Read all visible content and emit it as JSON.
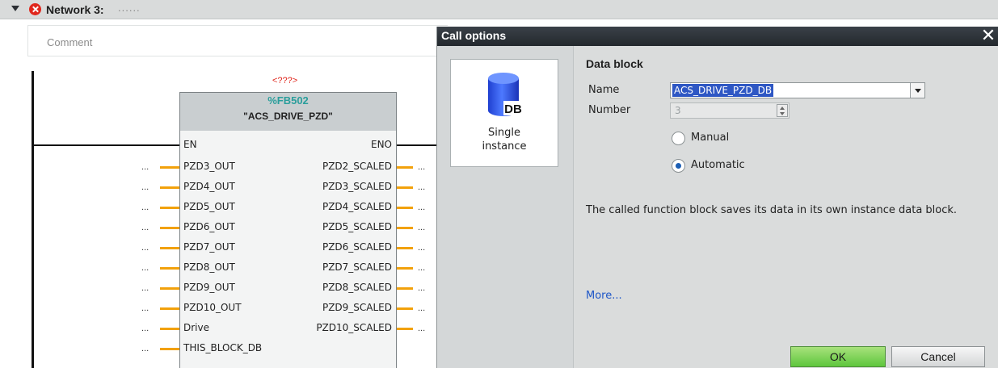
{
  "network": {
    "title": "Network 3:",
    "title_dots": "......",
    "comment_placeholder": "Comment"
  },
  "block": {
    "instance_label": "<???>",
    "number": "%FB502",
    "name": "\"ACS_DRIVE_PZD\"",
    "en_label": "EN",
    "eno_label": "ENO",
    "inputs": [
      "PZD3_OUT",
      "PZD4_OUT",
      "PZD5_OUT",
      "PZD6_OUT",
      "PZD7_OUT",
      "PZD8_OUT",
      "PZD9_OUT",
      "PZD10_OUT",
      "Drive",
      "THIS_BLOCK_DB"
    ],
    "outputs": [
      "PZD2_SCALED",
      "PZD3_SCALED",
      "PZD4_SCALED",
      "PZD5_SCALED",
      "PZD6_SCALED",
      "PZD7_SCALED",
      "PZD8_SCALED",
      "PZD9_SCALED",
      "PZD10_SCALED"
    ],
    "unconnected": "..."
  },
  "dialog": {
    "title": "Call options",
    "close_glyph": "✕",
    "tile": {
      "icon": "db-cylinder-icon",
      "icon_text": "DB",
      "line1": "Single",
      "line2": "instance"
    },
    "section_title": "Data block",
    "name_label": "Name",
    "name_value": "ACS_DRIVE_PZD_DB",
    "number_label": "Number",
    "number_value": "3",
    "radio_manual": "Manual",
    "radio_automatic": "Automatic",
    "selected_mode": "Automatic",
    "description": "The called function block saves its data in its own instance data block.",
    "more_link": "More...",
    "ok_label": "OK",
    "cancel_label": "Cancel"
  },
  "colors": {
    "error": "#e0271d",
    "fb_number": "#2a9e9b",
    "wire": "#f2a10b",
    "selection": "#2e57c4",
    "link": "#1f57c8",
    "ok_button": "#5ec63d"
  }
}
